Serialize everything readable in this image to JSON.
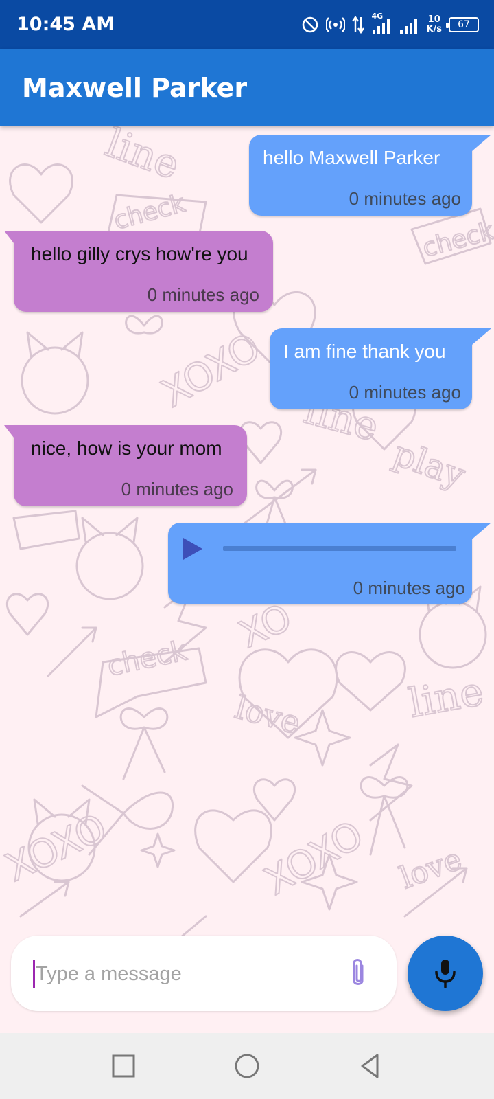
{
  "status_bar": {
    "time": "10:45 AM",
    "net_speed_value": "10",
    "net_speed_unit": "K/s",
    "network_type": "4G",
    "battery": "67",
    "icons": [
      "dnd-icon",
      "hotspot-icon",
      "data-arrows-icon",
      "signal-icon",
      "signal-icon",
      "battery-icon"
    ]
  },
  "header": {
    "title": "Maxwell Parker"
  },
  "messages": [
    {
      "direction": "out",
      "type": "text",
      "text": "hello Maxwell Parker",
      "time": "0 minutes ago"
    },
    {
      "direction": "in",
      "type": "text",
      "text": "hello gilly crys how're you",
      "time": "0 minutes ago"
    },
    {
      "direction": "out",
      "type": "text",
      "text": "I am fine thank you",
      "time": "0 minutes ago"
    },
    {
      "direction": "in",
      "type": "text",
      "text": "nice, how is your mom",
      "time": "0 minutes ago"
    },
    {
      "direction": "out",
      "type": "audio",
      "time": "0 minutes ago",
      "progress": 0
    }
  ],
  "composer": {
    "placeholder": "Type a message",
    "value": ""
  },
  "colors": {
    "status_bar": "#0a4aa3",
    "app_bar": "#1f76d4",
    "outgoing_bubble": "#64a1fb",
    "incoming_bubble": "#c47ecf",
    "chat_background": "#fff0f3",
    "mic_button": "#1f76d4"
  }
}
